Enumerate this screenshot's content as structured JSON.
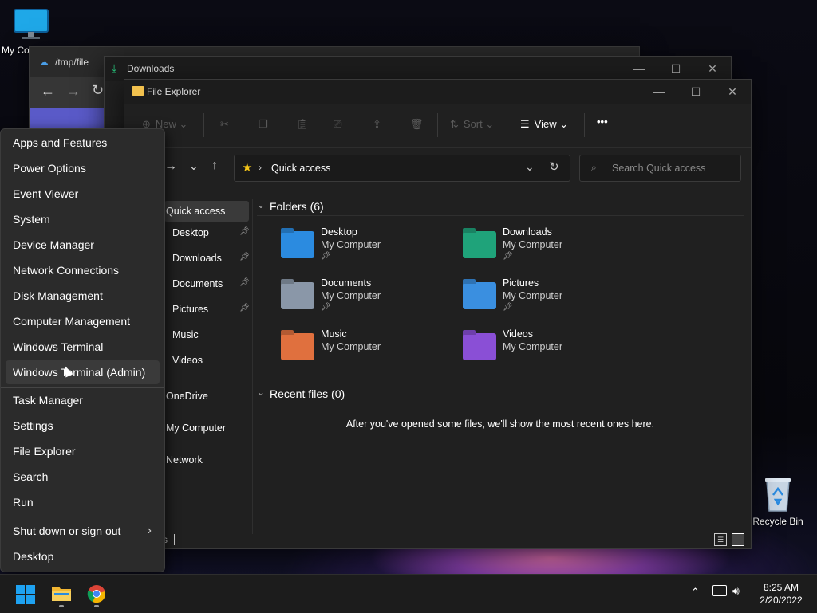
{
  "desktop": {
    "my_computer_label": "My Co",
    "recycle_bin_label": "Recycle Bin"
  },
  "back_window": {
    "title": "/tmp/file"
  },
  "downloads_window": {
    "title": "Downloads"
  },
  "explorer": {
    "title": "File Explorer",
    "toolbar": {
      "new_label": "New",
      "sort_label": "Sort",
      "view_label": "View",
      "more_label": "•••"
    },
    "address": {
      "path": "Quick access",
      "search_placeholder": "Search Quick access"
    },
    "nav": {
      "quick_access": "Quick access",
      "items": [
        {
          "label": "Desktop",
          "icon": "desktop-icon",
          "pinned": true
        },
        {
          "label": "Downloads",
          "icon": "downloads-icon",
          "pinned": true
        },
        {
          "label": "Documents",
          "icon": "documents-icon",
          "pinned": true
        },
        {
          "label": "Pictures",
          "icon": "pictures-icon",
          "pinned": true
        },
        {
          "label": "Music",
          "icon": "music-icon",
          "pinned": false
        },
        {
          "label": "Videos",
          "icon": "videos-icon",
          "pinned": false
        }
      ],
      "onedrive": "OneDrive",
      "my_computer": "My Computer",
      "network": "Network"
    },
    "folders_header": "Folders (6)",
    "folders": [
      {
        "name": "Desktop",
        "location": "My Computer",
        "pinned": true,
        "color": "#2b8be0"
      },
      {
        "name": "Downloads",
        "location": "My Computer",
        "pinned": true,
        "color": "#1fa37a"
      },
      {
        "name": "Documents",
        "location": "My Computer",
        "pinned": true,
        "color": "#8a97a8"
      },
      {
        "name": "Pictures",
        "location": "My Computer",
        "pinned": true,
        "color": "#3a8fe0"
      },
      {
        "name": "Music",
        "location": "My Computer",
        "pinned": false,
        "color": "#e0703e"
      },
      {
        "name": "Videos",
        "location": "My Computer",
        "pinned": false,
        "color": "#8a4fd6"
      }
    ],
    "recent_header": "Recent files (0)",
    "recent_empty": "After you've opened some files, we'll show the most recent ones here.",
    "status_text": "s"
  },
  "context_menu": {
    "group1": [
      "Apps and Features",
      "Power Options",
      "Event Viewer",
      "System",
      "Device Manager",
      "Network Connections",
      "Disk Management",
      "Computer Management",
      "Windows Terminal",
      "Windows Terminal (Admin)"
    ],
    "group2": [
      "Task Manager",
      "Settings",
      "File Explorer",
      "Search",
      "Run"
    ],
    "group3": [
      "Shut down or sign out",
      "Desktop"
    ],
    "hovered_index": 9
  },
  "taskbar": {
    "time": "8:25 AM",
    "date": "2/20/2022"
  },
  "colors": {
    "accent": "#0078d4",
    "folder_blue": "#2b8be0",
    "win_logo": "#1ea2f1"
  }
}
